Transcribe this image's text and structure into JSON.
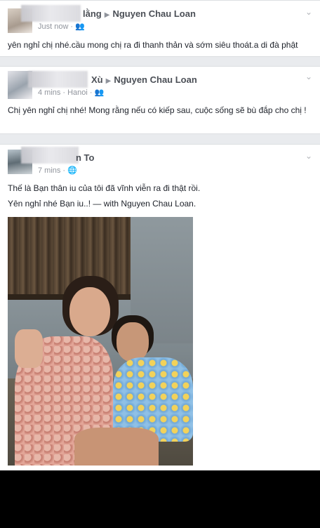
{
  "posts": [
    {
      "author_suffix": "lằng",
      "target": "Nguyen Chau Loan",
      "time": "Just now",
      "location": "",
      "privacy_icon": "friends-icon",
      "text": "yên nghỉ chị nhé.cầu mong chị ra đi thanh thản và sớm siêu thoát.a di đà phật"
    },
    {
      "author_suffix": "Xù",
      "target": "Nguyen Chau Loan",
      "time": "4 mins",
      "location": "Hanoi",
      "privacy_icon": "friends-icon",
      "text": "Chị yên nghỉ chị nhé! Mong rằng nếu có kiếp sau, cuộc sống sẽ bù đắp cho chị !"
    },
    {
      "author_suffix": "n To",
      "target": "",
      "time": "7 mins",
      "location": "",
      "privacy_icon": "globe-icon",
      "line1": "Thế là Bạn thân iu của tôi đã vĩnh viễn ra đi thật rồi.",
      "line2": "Yên nghỉ nhé Bạn iu..! — with Nguyen Chau Loan."
    }
  ],
  "colors": {
    "name": "#4b4f56",
    "meta": "#90949c",
    "text": "#1d2129",
    "feed_bg": "#e9ebee"
  }
}
